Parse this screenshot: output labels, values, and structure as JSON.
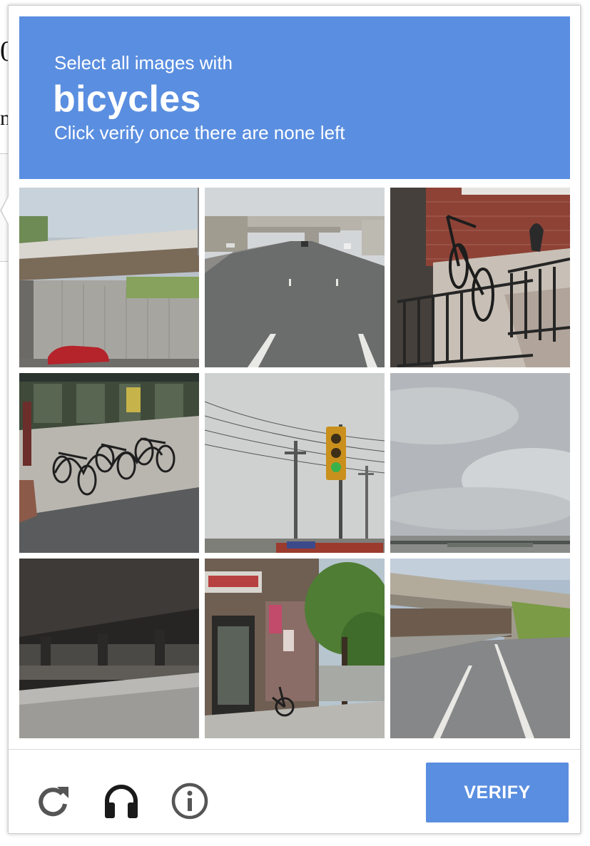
{
  "background_page": {
    "fragment_1": "0",
    "fragment_2": "n"
  },
  "challenge": {
    "instruction_line": "Select all images with",
    "target_word": "bicycles",
    "sub_instruction": "Click verify once there are none left",
    "header_color": "#5a8ee0",
    "tiles": [
      {
        "scene": "overpass-bridge-with-sound-wall-and-red-car"
      },
      {
        "scene": "highway-under-overpass"
      },
      {
        "scene": "bicycle-locked-to-iron-fence"
      },
      {
        "scene": "bicycle-rack-on-sidewalk"
      },
      {
        "scene": "traffic-light-and-power-poles"
      },
      {
        "scene": "cloudy-sky-over-waterfront"
      },
      {
        "scene": "dark-underside-of-bridge"
      },
      {
        "scene": "storefront-with-bicycle-and-tree"
      },
      {
        "scene": "road-passing-under-overpass"
      }
    ]
  },
  "footer": {
    "reload_icon": "reload-icon",
    "audio_icon": "headphones-icon",
    "info_icon": "info-icon",
    "verify_label": "VERIFY",
    "button_color": "#5a8ee0"
  }
}
